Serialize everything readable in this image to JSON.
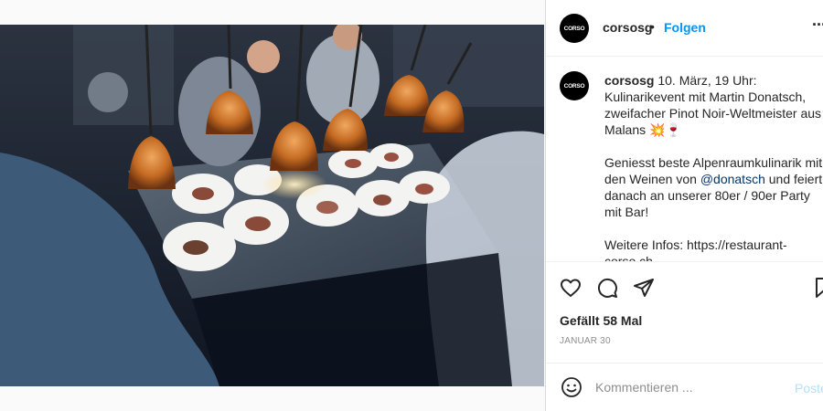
{
  "post": {
    "logo_text": "CORSO",
    "username": "corsosg",
    "separator": "•",
    "follow_label": "Folgen",
    "more_label": "···",
    "caption": {
      "username": "corsosg",
      "line1": "10. März, 19 Uhr: Kulinarikevent mit Martin Donatsch, zweifacher Pinot Noir-Weltmeister aus Malans 💥🍷",
      "line2_before": "Geniesst beste Alpenraumkulinarik mit den Weinen von ",
      "mention": "@donatsch",
      "line2_after": " und feiert danach an unserer 80er / 90er Party mit Bar!",
      "line3": "Weitere Infos: https://restaurant-corso.ch"
    },
    "likes_label": "Gefällt 58 Mal",
    "date_label": "JANUAR 30",
    "comment_placeholder": "Kommentieren ...",
    "post_button_label": "Posten"
  },
  "icons": [
    "heart-icon",
    "comment-icon",
    "share-icon",
    "bookmark-icon",
    "emoji-icon"
  ],
  "colors": {
    "follow_blue": "#0095f6",
    "post_button_disabled": "#b2dffc",
    "mention_blue": "#00376b",
    "lamp_copper": "#c9702a"
  }
}
